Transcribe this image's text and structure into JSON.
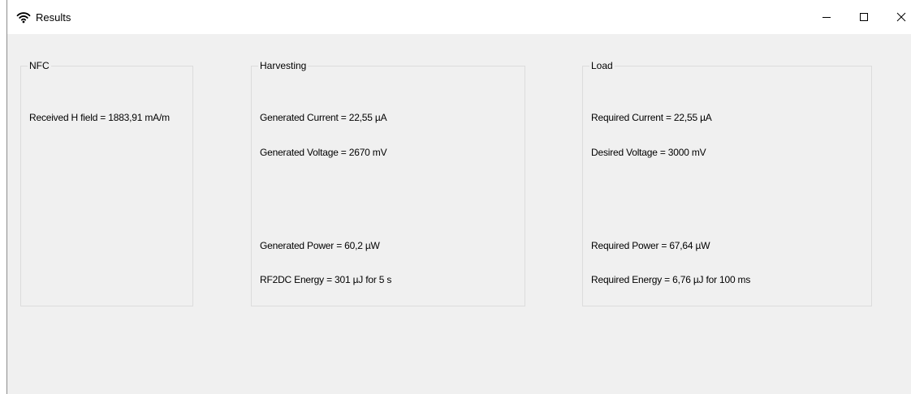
{
  "window": {
    "title": "Results",
    "icon": "wifi-icon",
    "buttons": {
      "minimize": "minimize-icon",
      "maximize": "maximize-icon",
      "close": "close-icon"
    }
  },
  "groups": {
    "nfc": {
      "title": "NFC",
      "received_h_field": "Received H field = 1883,91 mA/m"
    },
    "harvesting": {
      "title": "Harvesting",
      "generated_current": "Generated Current = 22,55 µA",
      "generated_voltage": "Generated Voltage = 2670 mV",
      "generated_power": "Generated Power = 60,2 µW",
      "rf2dc_energy": "RF2DC Energy = 301 µJ for 5 s"
    },
    "load": {
      "title": "Load",
      "required_current": "Required Current = 22,55 µA",
      "desired_voltage": "Desired Voltage = 3000 mV",
      "required_power": "Required Power = 67,64 µW",
      "required_energy": "Required Energy = 6,76 µJ for 100 ms"
    }
  },
  "colors": {
    "window_background": "#f0f0f0",
    "titlebar_background": "#ffffff",
    "groupbox_border": "#dcdcdc"
  }
}
